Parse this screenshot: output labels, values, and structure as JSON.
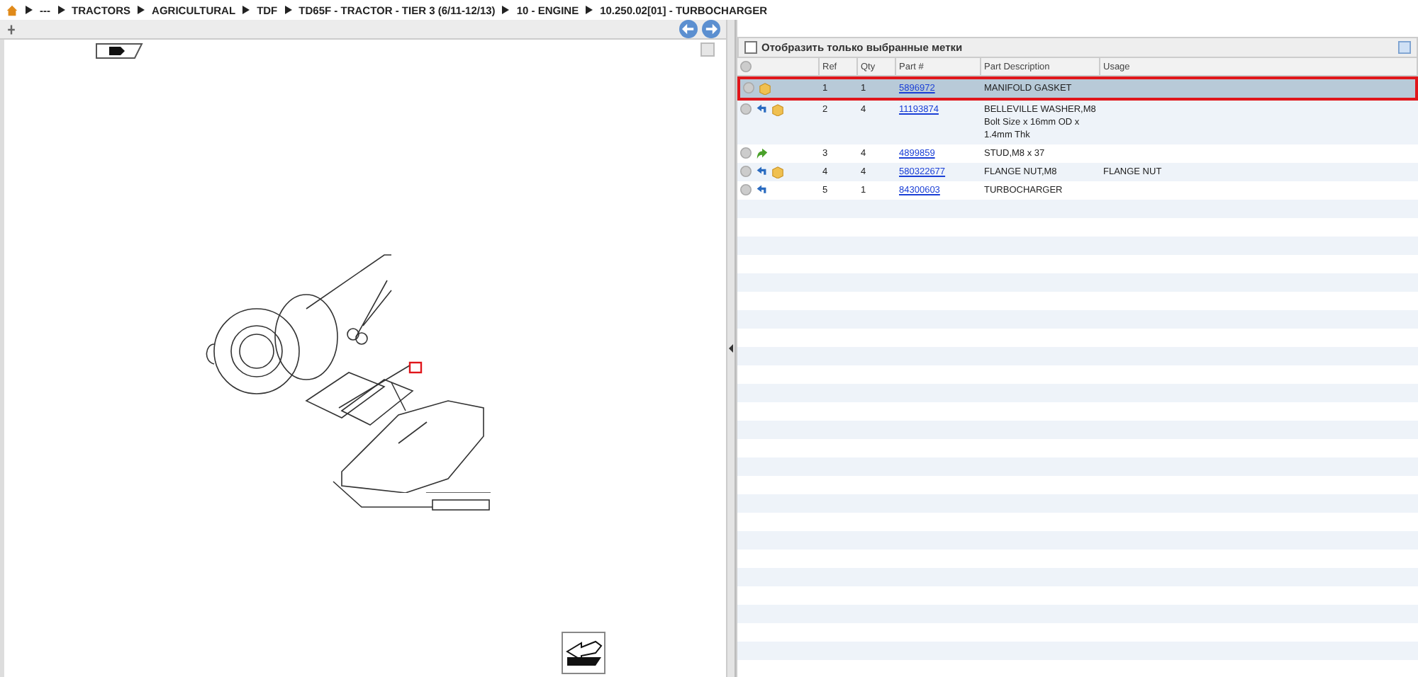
{
  "breadcrumb": [
    "---",
    "TRACTORS",
    "AGRICULTURAL",
    "TDF",
    "TD65F - TRACTOR - TIER 3 (6/11-12/13)",
    "10 - ENGINE",
    "10.250.02[01] - TURBOCHARGER"
  ],
  "filter": {
    "label": "Отобразить только выбранные метки",
    "checked": false
  },
  "table": {
    "columns": [
      "Ref",
      "Qty",
      "Part #",
      "Part Description",
      "Usage"
    ],
    "rows": [
      {
        "icons": [
          {
            "kind": "package"
          }
        ],
        "ref": "1",
        "qty": "1",
        "part": "5896972",
        "description": "MANIFOLD GASKET",
        "selected": true
      },
      {
        "icons": [
          {
            "kind": "blue-arrow"
          },
          {
            "kind": "package"
          }
        ],
        "ref": "2",
        "qty": "4",
        "part": "11193874",
        "description": "BELLEVILLE WASHER,M8 Bolt Size x 16mm OD x 1.4mm Thk",
        "selected": false
      },
      {
        "icons": [
          {
            "kind": "green-arrow"
          }
        ],
        "ref": "3",
        "qty": "4",
        "part": "4899859",
        "description": "STUD,M8 x 37",
        "selected": false
      },
      {
        "icons": [
          {
            "kind": "blue-arrow"
          },
          {
            "kind": "package"
          }
        ],
        "ref": "4",
        "qty": "4",
        "part": "580322677",
        "description": "FLANGE NUT,M8",
        "usage": "FLANGE NUT",
        "selected": false
      },
      {
        "icons": [
          {
            "kind": "blue-arrow"
          }
        ],
        "ref": "5",
        "qty": "1",
        "part": "84300603",
        "description": "TURBOCHARGER",
        "selected": false
      }
    ]
  }
}
